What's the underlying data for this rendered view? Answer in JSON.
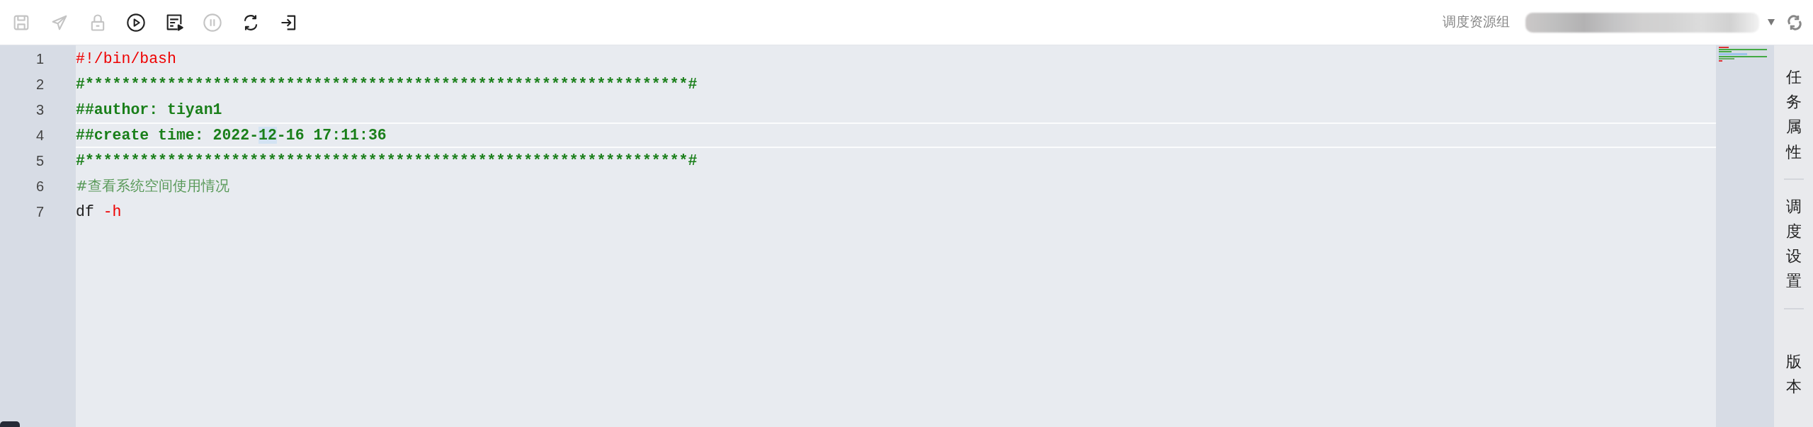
{
  "toolbar": {
    "buttons": [
      {
        "kind": "save",
        "disabled": true
      },
      {
        "kind": "send",
        "disabled": true
      },
      {
        "kind": "lock",
        "disabled": true
      },
      {
        "kind": "play",
        "disabled": false
      },
      {
        "kind": "run-list",
        "disabled": false
      },
      {
        "kind": "pause",
        "disabled": true
      },
      {
        "kind": "refresh",
        "disabled": false
      },
      {
        "kind": "exit",
        "disabled": false
      }
    ]
  },
  "resource_group": {
    "label": "调度资源组"
  },
  "editor": {
    "lines": [
      {
        "number": "1",
        "current": false,
        "tokens": [
          {
            "text": "#!/bin/bash",
            "kind": "shebang"
          }
        ]
      },
      {
        "number": "2",
        "current": false,
        "tokens": [
          {
            "text": "#******************************************************************#",
            "kind": "comment"
          }
        ]
      },
      {
        "number": "3",
        "current": false,
        "tokens": [
          {
            "text": "##author: tiyan1",
            "kind": "comment"
          }
        ]
      },
      {
        "number": "4",
        "current": true,
        "tokens": [
          {
            "text": "##create time: 2022-",
            "kind": "comment"
          },
          {
            "text": "12",
            "kind": "comment",
            "highlight": true
          },
          {
            "text": "-16 17:11:36",
            "kind": "comment"
          }
        ]
      },
      {
        "number": "5",
        "current": false,
        "tokens": [
          {
            "text": "#******************************************************************#",
            "kind": "comment"
          }
        ]
      },
      {
        "number": "6",
        "current": false,
        "tokens": [
          {
            "text": "#查看系统空间使用情况",
            "kind": "comment-cjk"
          }
        ]
      },
      {
        "number": "7",
        "current": false,
        "tokens": [
          {
            "text": "df ",
            "kind": "plain"
          },
          {
            "text": "-h",
            "kind": "flag"
          }
        ]
      }
    ]
  },
  "side_tabs": [
    {
      "label": "任务属性"
    },
    {
      "label": "调度设置"
    },
    {
      "label": "版本"
    }
  ]
}
